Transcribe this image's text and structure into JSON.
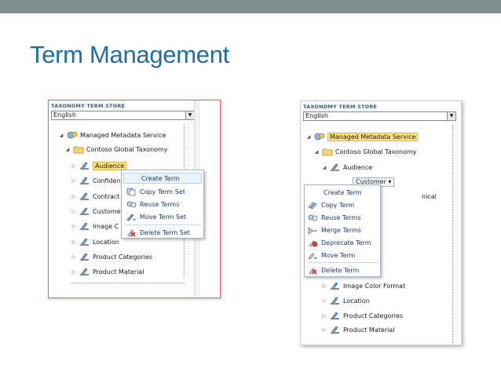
{
  "slide": {
    "title": "Term Management"
  },
  "left": {
    "store_header": "TAXONOMY TERM STORE",
    "language": "English",
    "tree": [
      {
        "label": "Managed Metadata Service",
        "expander": "◢"
      },
      {
        "label": "Contoso Global Taxonomy",
        "expander": "◢"
      },
      {
        "label": "Audience",
        "expander": "▷"
      },
      {
        "label": "Confiden",
        "expander": "▷"
      },
      {
        "label": "Contract",
        "expander": "▷"
      },
      {
        "label": "Custome",
        "expander": "▷"
      },
      {
        "label": "Image C",
        "expander": "▷"
      },
      {
        "label": "Location",
        "expander": "▷"
      },
      {
        "label": "Product Categories",
        "expander": "▷"
      },
      {
        "label": "Product Material",
        "expander": "▷"
      }
    ],
    "menu": [
      {
        "label": "Create Term"
      },
      {
        "label": "Copy Term Set"
      },
      {
        "label": "Reuse Terms"
      },
      {
        "label": "Move Term Set"
      },
      {
        "label": "Delete Term Set"
      }
    ]
  },
  "right": {
    "store_header": "TAXONOMY TERM STORE",
    "language": "English",
    "tree": [
      {
        "label": "Managed Metadata Service",
        "expander": "◢"
      },
      {
        "label": "Contoso Global Taxonomy",
        "expander": "◢"
      },
      {
        "label": "Audience",
        "expander": "◢"
      },
      {
        "label": "Customer ▾"
      },
      {
        "label": "nical"
      },
      {
        "label": "Image Color Format",
        "expander": "▷"
      },
      {
        "label": "Location",
        "expander": "▷"
      },
      {
        "label": "Product Categories",
        "expander": "▷"
      },
      {
        "label": "Product Material",
        "expander": "▷"
      }
    ],
    "menu": [
      {
        "label": "Create Term"
      },
      {
        "label": "Copy Term"
      },
      {
        "label": "Reuse Terms"
      },
      {
        "label": "Merge Terms"
      },
      {
        "label": "Deprecate Term"
      },
      {
        "label": "Move Term"
      },
      {
        "label": "Delete Term"
      }
    ]
  },
  "colors": {
    "title": "#1f6ea3",
    "top_bar": "#7f918e",
    "highlight": "#ffe37a",
    "menu_text": "#1a3a6e"
  }
}
